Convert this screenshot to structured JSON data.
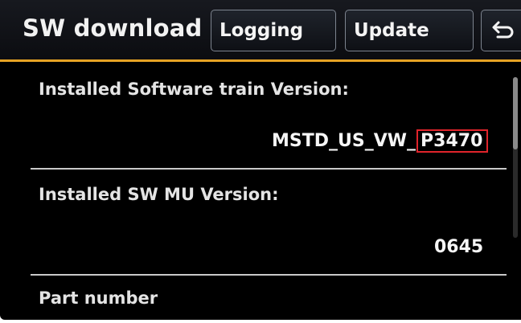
{
  "header": {
    "title": "SW download",
    "buttons": {
      "logging_label": "Logging",
      "update_label": "Update",
      "back_icon": "back-arrow-icon"
    },
    "accent_color": "#e6a324"
  },
  "info": {
    "software_train": {
      "label": "Installed Software train Version:",
      "value_prefix": "MSTD_US_VW_",
      "value_highlight": "P3470",
      "highlight_color": "#e0242b"
    },
    "sw_mu": {
      "label": "Installed SW MU Version:",
      "value": "0645"
    },
    "part_number": {
      "label": "Part number"
    }
  }
}
